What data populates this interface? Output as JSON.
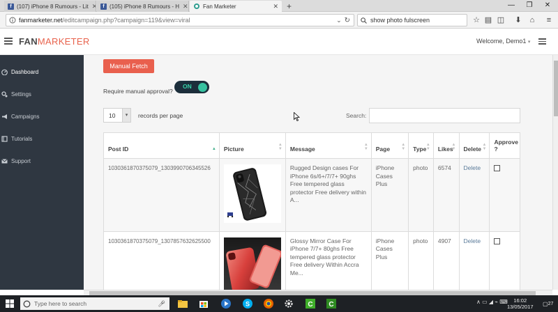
{
  "browser": {
    "tabs": [
      {
        "title": "(107) iPhone 8 Rumours - Lit",
        "active": false
      },
      {
        "title": "(105) iPhone 8 Rumours - H",
        "active": false
      },
      {
        "title": "Fan Marketer",
        "active": true
      }
    ],
    "new_tab_label": "+",
    "url_host": "fanmarketer.net",
    "url_path": "/editcampaign.php?campaign=119&view=viral",
    "search_text": "show photo fulscreen"
  },
  "app": {
    "logo_part1": "FAN",
    "logo_part2": "MARKETER",
    "welcome": "Welcome, Demo1",
    "welcome_caret": "▾"
  },
  "sidebar": {
    "items": [
      {
        "label": "Dashboard",
        "icon": "dashboard-icon"
      },
      {
        "label": "Settings",
        "icon": "gears-icon"
      },
      {
        "label": "Campaigns",
        "icon": "bullhorn-icon"
      },
      {
        "label": "Tutorials",
        "icon": "book-icon"
      },
      {
        "label": "Support",
        "icon": "envelope-icon"
      }
    ]
  },
  "page": {
    "manual_fetch": "Manual Fetch",
    "require_approval_label": "Require manual approval?",
    "toggle_label": "ON",
    "length_value": "10",
    "records_label": "records per page",
    "search_label": "Search:"
  },
  "table": {
    "headers": [
      "Post ID",
      "Picture",
      "Message",
      "Page",
      "Type",
      "Likes",
      "Delete",
      "Approve ?"
    ],
    "rows": [
      {
        "post_id": "1030361870375079_1303990706345526",
        "message": "Rugged Design cases For iPhone 6s/6+/7/7+ 90ghs Free tempered glass protector Free delivery within A...",
        "page": "iPhone Cases Plus",
        "type": "photo",
        "likes": "6574",
        "delete": "Delete"
      },
      {
        "post_id": "1030361870375079_1307857632625500",
        "message": "Glossy Mirror Case For iPhone 7/7+ 80ghs Free tempered glass protector Free delivery Within Accra Me...",
        "page": "iPhone Cases Plus",
        "type": "photo",
        "likes": "4907",
        "delete": "Delete"
      }
    ]
  },
  "taskbar": {
    "search_placeholder": "Type here to search",
    "time": "16:02",
    "date": "13/05/2017",
    "notification_count": "27"
  },
  "colors": {
    "accent": "#e9604e",
    "sidebar_bg": "#2f3741",
    "toggle_on": "#36c2a0"
  }
}
